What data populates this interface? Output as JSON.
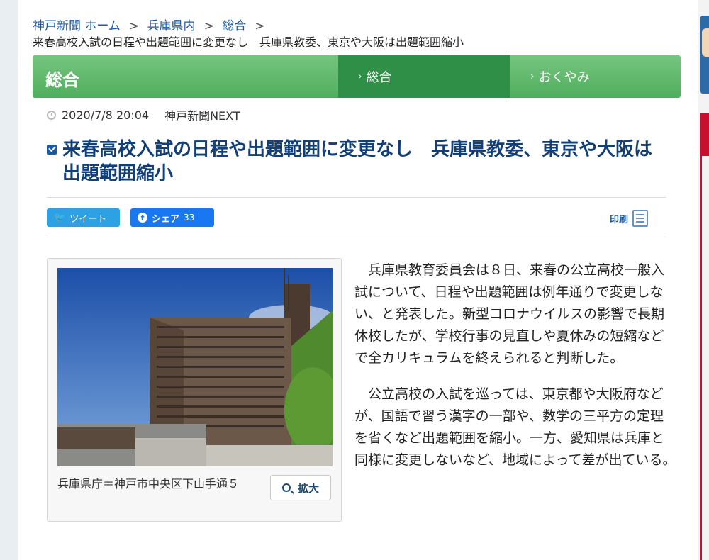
{
  "breadcrumb": {
    "items": [
      "神戸新聞 ホーム",
      "兵庫県内",
      "総合"
    ],
    "separator": ">"
  },
  "article_subtitle": "来春高校入試の日程や出題範囲に変更なし　兵庫県教委、東京や大阪は出題範囲縮小",
  "nav": {
    "title": "総合",
    "tabs": [
      {
        "label": "総合",
        "active": true
      },
      {
        "label": "おくやみ",
        "active": false
      }
    ]
  },
  "meta": {
    "datetime": "2020/7/8 20:04",
    "source": "神戸新聞NEXT"
  },
  "headline": "来春高校入試の日程や出題範囲に変更なし　兵庫県教委、東京や大阪は出題範囲縮小",
  "share": {
    "tweet_label": "ツイート",
    "share_label": "シェア",
    "share_count": "33",
    "print_label": "印刷"
  },
  "figure": {
    "caption": "兵庫県庁＝神戸市中央区下山手通５",
    "zoom_label": "拡大"
  },
  "body": {
    "paragraphs": [
      "兵庫県教育委員会は８日、来春の公立高校一般入試について、日程や出題範囲は例年通りで変更しない、と発表した。新型コロナウイルスの影響で長期休校したが、学校行事の見直しや夏休みの短縮などで全カリキュラムを終えられると判断した。",
      "公立高校の入試を巡っては、東京都や大阪府などが、国語で習う漢字の一部や、数学の三平方の定理を省くなど出題範囲を縮小。一方、愛知県は兵庫と同様に変更しないなど、地域によって差が出ている。"
    ]
  },
  "colors": {
    "nav_green": "#4fae5e",
    "nav_active": "#2f8f46",
    "headline_blue": "#123f78",
    "twitter": "#2ea0e4",
    "facebook": "#1977f2"
  }
}
